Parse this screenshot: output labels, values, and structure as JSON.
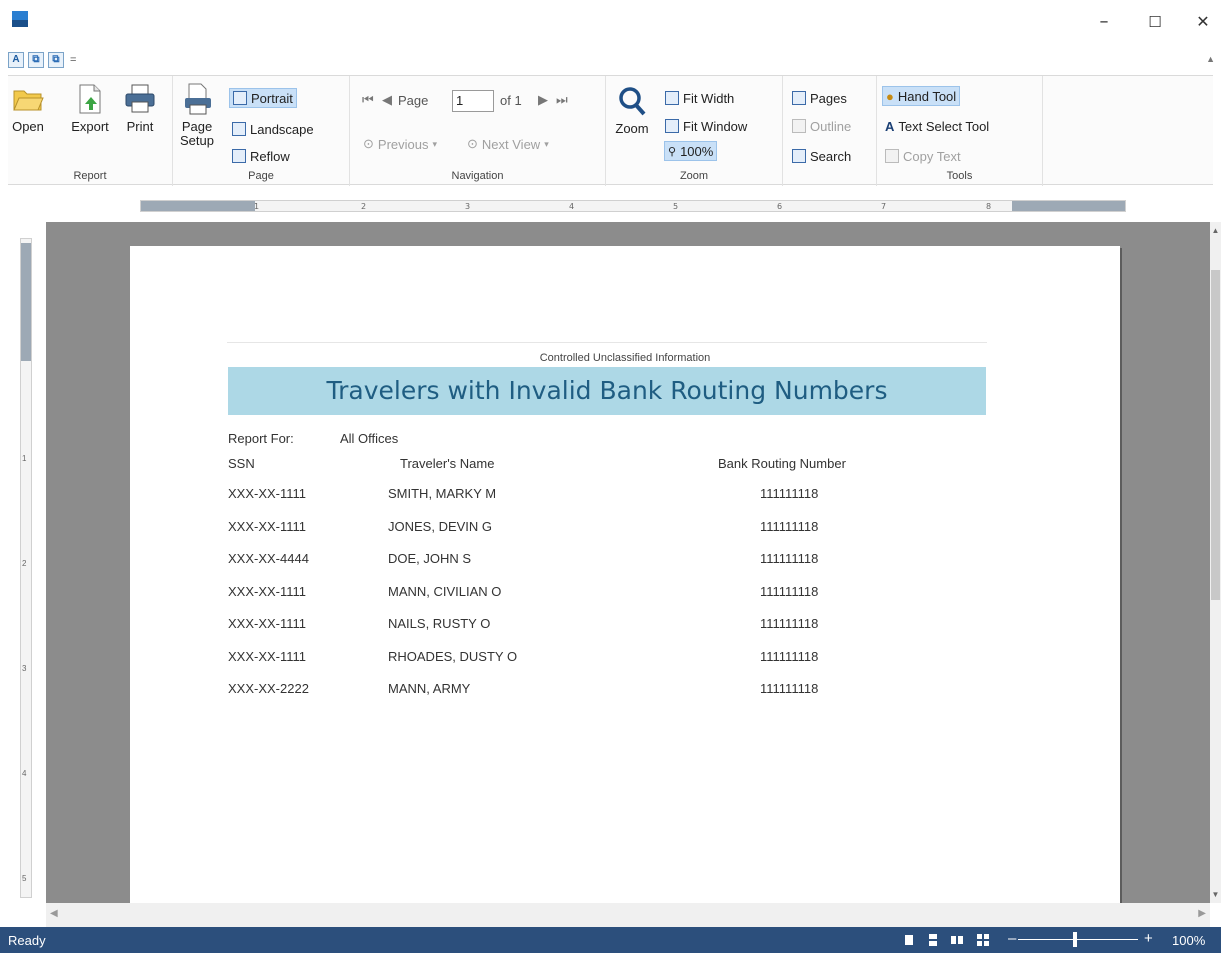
{
  "window": {
    "minimize": "–",
    "maximize": "☐",
    "close": "✕"
  },
  "qat": {
    "btn1": "A",
    "btn2": "⧉",
    "btn3": "⧉",
    "more": "="
  },
  "ribbon": {
    "report": {
      "label": "Report",
      "open": "Open",
      "export": "Export",
      "print": "Print"
    },
    "page": {
      "label": "Page",
      "setup_line1": "Page",
      "setup_line2": "Setup",
      "portrait": "Portrait",
      "landscape": "Landscape",
      "reflow": "Reflow"
    },
    "navigation": {
      "label": "Navigation",
      "page_word": "Page",
      "page_value": "1",
      "of_total": "of 1",
      "previous": "Previous",
      "next_view": "Next View"
    },
    "zoom": {
      "label": "Zoom",
      "zoom": "Zoom",
      "fit_width": "Fit Width",
      "fit_window": "Fit Window",
      "hundred": "100%"
    },
    "panels": {
      "pages": "Pages",
      "outline": "Outline",
      "search": "Search"
    },
    "tools": {
      "label": "Tools",
      "hand_tool": "Hand Tool",
      "text_select_tool": "Text Select Tool",
      "copy_text": "Copy Text"
    }
  },
  "ruler": {
    "ticks": [
      "1",
      "2",
      "3",
      "4",
      "5",
      "6",
      "7",
      "8"
    ],
    "vticks": [
      "1",
      "2",
      "3",
      "4",
      "5"
    ]
  },
  "report": {
    "classification": "Controlled Unclassified Information",
    "title": "Travelers with Invalid Bank Routing Numbers",
    "report_for_label": "Report For:",
    "report_for_value": "All Offices",
    "columns": {
      "ssn": "SSN",
      "name": "Traveler's Name",
      "routing": "Bank Routing Number"
    },
    "rows": [
      {
        "ssn": "XXX-XX-1111",
        "name": "SMITH, MARKY M",
        "routing": "111111118"
      },
      {
        "ssn": "XXX-XX-1111",
        "name": "JONES, DEVIN G",
        "routing": "111111118"
      },
      {
        "ssn": "XXX-XX-4444",
        "name": "DOE, JOHN S",
        "routing": "111111118"
      },
      {
        "ssn": "XXX-XX-1111",
        "name": "MANN, CIVILIAN O",
        "routing": "111111118"
      },
      {
        "ssn": "XXX-XX-1111",
        "name": "NAILS, RUSTY O",
        "routing": "111111118"
      },
      {
        "ssn": "XXX-XX-1111",
        "name": "RHOADES, DUSTY O",
        "routing": "111111118"
      },
      {
        "ssn": "XXX-XX-2222",
        "name": "MANN, ARMY",
        "routing": "111111118"
      }
    ]
  },
  "status": {
    "text": "Ready",
    "zoom_minus": "–",
    "zoom_plus": "+",
    "zoom_level": "100%"
  },
  "colors": {
    "status_bar": "#2c4f7c",
    "title_band": "#add8e6",
    "title_text": "#1f5d82",
    "viewer_bg": "#8c8c8c",
    "selected_tool": "#c9e0f7"
  }
}
